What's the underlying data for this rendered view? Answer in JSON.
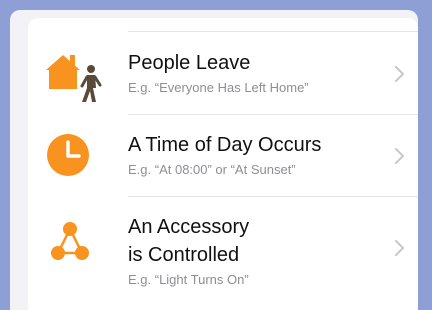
{
  "triggers": [
    {
      "title": "People Leave",
      "subtitle": "E.g. “Everyone Has Left Home”",
      "icon": "home-person-leaving-icon"
    },
    {
      "title": "A Time of Day Occurs",
      "subtitle": "E.g. “At 08:00” or “At Sunset”",
      "icon": "clock-icon"
    },
    {
      "title_line1": "An Accessory",
      "title_line2": "is Controlled",
      "subtitle": "E.g. “Light Turns On”",
      "icon": "accessory-network-icon"
    }
  ],
  "colors": {
    "accent": "#f7931e",
    "person": "#5a4a3a",
    "chevron": "#c7c7cc",
    "background": "#8e9fd6"
  }
}
